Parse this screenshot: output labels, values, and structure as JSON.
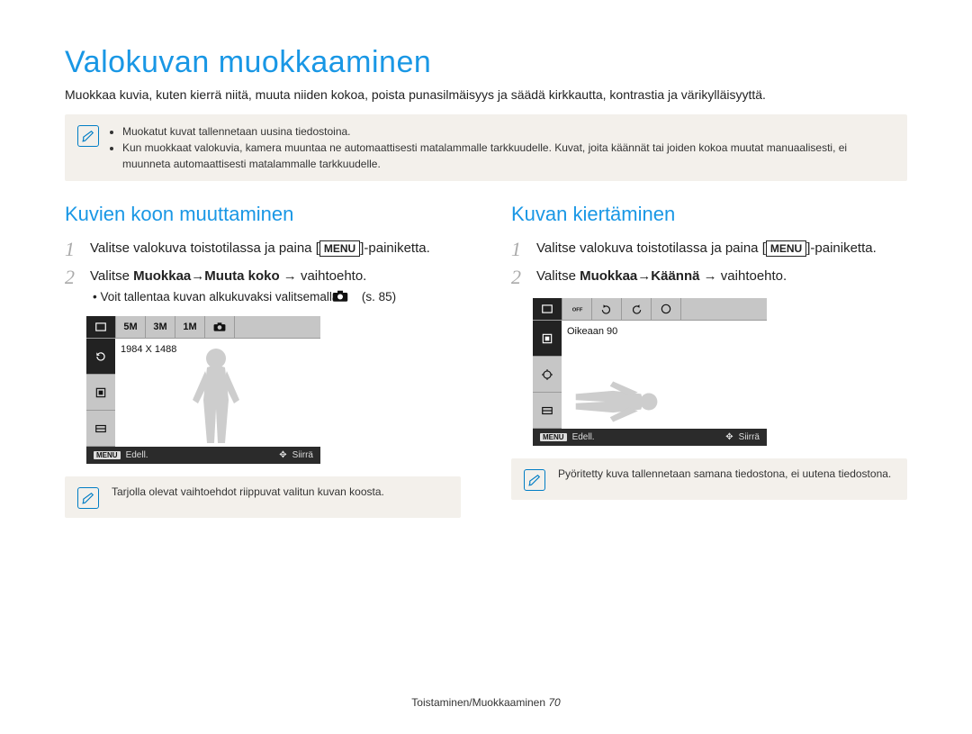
{
  "title": "Valokuvan muokkaaminen",
  "intro": "Muokkaa kuvia, kuten kierrä niitä, muuta niiden kokoa, poista punasilmäisyys ja säädä kirkkautta, kontrastia ja värikylläisyyttä.",
  "topnote": {
    "items": [
      "Muokatut kuvat tallennetaan uusina tiedostoina.",
      "Kun muokkaat valokuvia, kamera muuntaa ne automaattisesti matalammalle tarkkuudelle. Kuvat, joita käännät tai joiden kokoa muutat manuaalisesti, ei muunneta automaattisesti matalammalle tarkkuudelle."
    ]
  },
  "left": {
    "heading": "Kuvien koon muuttaminen",
    "step1_pre": "Valitse valokuva toistotilassa ja paina [",
    "step1_key": "MENU",
    "step1_post": "]-painiketta.",
    "step2_pre": "Valitse ",
    "step2_b1": "Muokkaa",
    "step2_arrow": " → ",
    "step2_b2": "Muuta koko",
    "step2_post": " → vaihtoehto.",
    "sub_bullet": "Voit tallentaa kuvan alkukuvaksi valitsemalla ",
    "sub_ref": " (s. 85)",
    "screen": {
      "top": [
        "",
        "5M",
        "3M",
        "1M",
        ""
      ],
      "caption": "1984 X 1488",
      "back_key": "MENU",
      "back_label": "Edell.",
      "move_label": "Siirrä"
    },
    "bottomnote": "Tarjolla olevat vaihtoehdot riippuvat valitun kuvan koosta."
  },
  "right": {
    "heading": "Kuvan kiertäminen",
    "step1_pre": "Valitse valokuva toistotilassa ja paina [",
    "step1_key": "MENU",
    "step1_post": "]-painiketta.",
    "step2_pre": "Valitse ",
    "step2_b1": "Muokkaa",
    "step2_arrow": " → ",
    "step2_b2": "Käännä",
    "step2_post": " → vaihtoehto.",
    "screen": {
      "caption": "Oikeaan 90",
      "back_key": "MENU",
      "back_label": "Edell.",
      "move_label": "Siirrä"
    },
    "bottomnote": "Pyöritetty kuva tallennetaan samana tiedostona, ei uutena tiedostona."
  },
  "footer": {
    "path": "Toistaminen/Muokkaaminen",
    "page": "70"
  }
}
